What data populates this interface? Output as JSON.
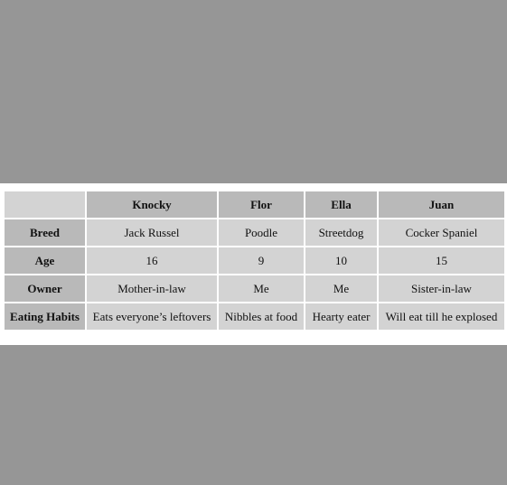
{
  "table": {
    "columns": [
      "",
      "Knocky",
      "Flor",
      "Ella",
      "Juan"
    ],
    "rows": [
      {
        "label": "Breed",
        "cells": [
          "Jack Russel",
          "Poodle",
          "Streetdog",
          "Cocker Spaniel"
        ]
      },
      {
        "label": "Age",
        "cells": [
          "16",
          "9",
          "10",
          "15"
        ]
      },
      {
        "label": "Owner",
        "cells": [
          "Mother-in-law",
          "Me",
          "Me",
          "Sister-in-law"
        ]
      },
      {
        "label": "Eating Habits",
        "cells": [
          "Eats everyone’s leftovers",
          "Nibbles at food",
          "Hearty eater",
          "Will eat till he explosed"
        ]
      }
    ]
  },
  "colors": {
    "background": "#969696",
    "frame": "#ffffff",
    "header_cell": "#b9b9b9",
    "body_cell": "#d3d3d3"
  }
}
